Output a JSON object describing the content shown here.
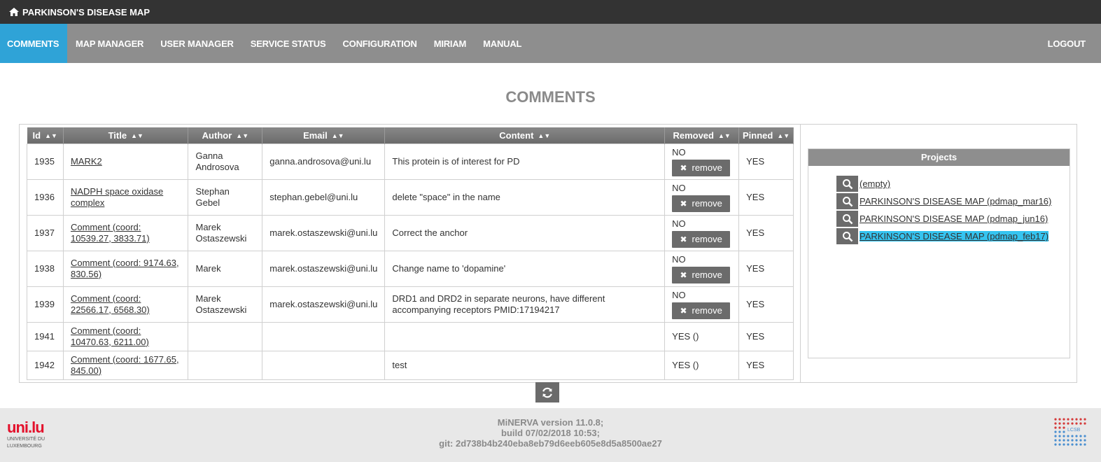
{
  "app": {
    "title": "PARKINSON'S DISEASE MAP"
  },
  "nav": {
    "items": [
      {
        "label": "COMMENTS",
        "active": true
      },
      {
        "label": "MAP MANAGER"
      },
      {
        "label": "USER MANAGER"
      },
      {
        "label": "SERVICE STATUS"
      },
      {
        "label": "CONFIGURATION"
      },
      {
        "label": "MIRIAM"
      },
      {
        "label": "MANUAL"
      }
    ],
    "logout": "LOGOUT"
  },
  "page_title": "COMMENTS",
  "table": {
    "headers": [
      "Id",
      "Title",
      "Author",
      "Email",
      "Content",
      "Removed",
      "Pinned"
    ],
    "remove_label": "remove",
    "rows": [
      {
        "id": "1935",
        "title": "MARK2",
        "author": "Ganna Androsova",
        "email": "ganna.androsova@uni.lu",
        "content": "This protein is of interest for PD",
        "removed": "NO",
        "pinned": "YES"
      },
      {
        "id": "1936",
        "title": "NADPH space oxidase complex",
        "author": "Stephan Gebel",
        "email": "stephan.gebel@uni.lu",
        "content": "delete \"space\" in the name",
        "removed": "NO",
        "pinned": "YES"
      },
      {
        "id": "1937",
        "title": "Comment (coord: 10539.27, 3833.71)",
        "author": "Marek Ostaszewski",
        "email": "marek.ostaszewski@uni.lu",
        "content": "Correct the anchor",
        "removed": "NO",
        "pinned": "YES"
      },
      {
        "id": "1938",
        "title": "Comment (coord: 9174.63, 830.56)",
        "author": "Marek",
        "email": "marek.ostaszewski@uni.lu",
        "content": "Change name to 'dopamine'",
        "removed": "NO",
        "pinned": "YES"
      },
      {
        "id": "1939",
        "title": "Comment (coord: 22566.17, 6568.30)",
        "author": "Marek Ostaszewski",
        "email": "marek.ostaszewski@uni.lu",
        "content": "DRD1 and DRD2 in separate neurons, have different accompanying receptors PMID:17194217",
        "removed": "NO",
        "pinned": "YES"
      },
      {
        "id": "1941",
        "title": "Comment (coord: 10470.63, 6211.00)",
        "author": "",
        "email": "",
        "content": "",
        "removed": "YES ()",
        "pinned": "YES"
      },
      {
        "id": "1942",
        "title": "Comment (coord: 1677.65, 845.00)",
        "author": "",
        "email": "",
        "content": "test",
        "removed": "YES ()",
        "pinned": "YES"
      }
    ]
  },
  "projects": {
    "heading": "Projects",
    "items": [
      {
        "label": " (empty)"
      },
      {
        "label": "PARKINSON'S DISEASE MAP (pdmap_mar16)"
      },
      {
        "label": "PARKINSON'S DISEASE MAP (pdmap_jun16)"
      },
      {
        "label": "PARKINSON'S DISEASE MAP (pdmap_feb17)",
        "selected": true
      }
    ]
  },
  "footer": {
    "version_line1": "MiNERVA version 11.0.8;",
    "version_line2": "build 07/02/2018 10:53;",
    "version_line3": "git: 2d738b4b240eba8eb79d6eeb605e8d5a8500ae27",
    "uni_logo_word": "uni.lu",
    "uni_logo_sub1": "UNIVERSITÉ DU",
    "uni_logo_sub2": "LUXEMBOURG",
    "lcsb_text": "LCSB"
  },
  "colors": {
    "active_tab": "#2fa3d7",
    "topbar": "#333333",
    "navbar": "#8e8e8e",
    "selected_project": "#35c4f0",
    "button": "#6b6b6b"
  },
  "icons": {
    "home": "home-icon",
    "sort": "sort-icon",
    "remove": "close-icon",
    "search": "search-icon",
    "refresh": "refresh-icon"
  }
}
